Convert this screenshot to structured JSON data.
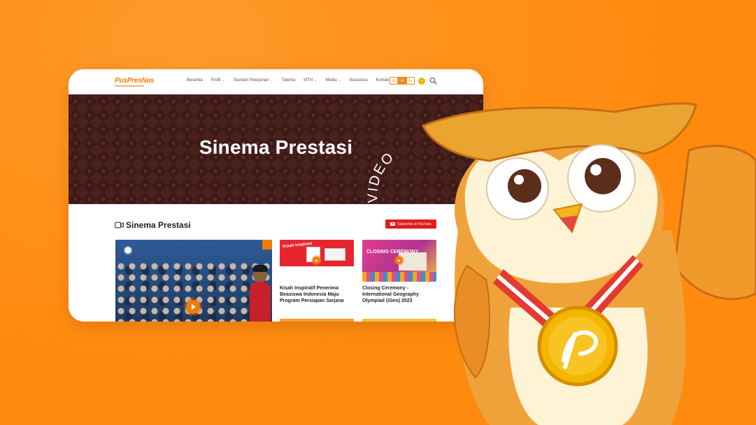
{
  "site": {
    "logo_text": "PusPresNas"
  },
  "nav": {
    "items": [
      {
        "label": "Beranda",
        "has_dropdown": false
      },
      {
        "label": "Profil",
        "has_dropdown": true
      },
      {
        "label": "Standar Pelayanan",
        "has_dropdown": true
      },
      {
        "label": "Talenta",
        "has_dropdown": false
      },
      {
        "label": "MTN",
        "has_dropdown": true
      },
      {
        "label": "Media",
        "has_dropdown": true
      },
      {
        "label": "Beasiswa",
        "has_dropdown": false
      },
      {
        "label": "Kontak",
        "has_dropdown": false
      }
    ],
    "font_tools": [
      "A-",
      "A",
      "A+"
    ],
    "contrast_label": "◐",
    "chevron": "⌄"
  },
  "hero": {
    "title": "Sinema Prestasi"
  },
  "overlay_text": "VIDEO",
  "section": {
    "title": "Sinema Prestasi",
    "subscribe_label": "Subscribe di YouTube"
  },
  "videos": [
    {
      "caption": "Kisah Inspiratif Penerima Beasiswa Indonesia Maju Program Persiapan Sarjana",
      "thumb_label": "Kisah inspirasi"
    },
    {
      "caption": "Closing Ceremony - International Geography Olympiad (iGeo) 2023",
      "thumb_label": "CLOSING CEREMONY"
    }
  ],
  "colors": {
    "background": "#FF8A0E",
    "accent": "#F07A0C",
    "youtube": "#E31B1B",
    "hero": "#3B1A18"
  }
}
